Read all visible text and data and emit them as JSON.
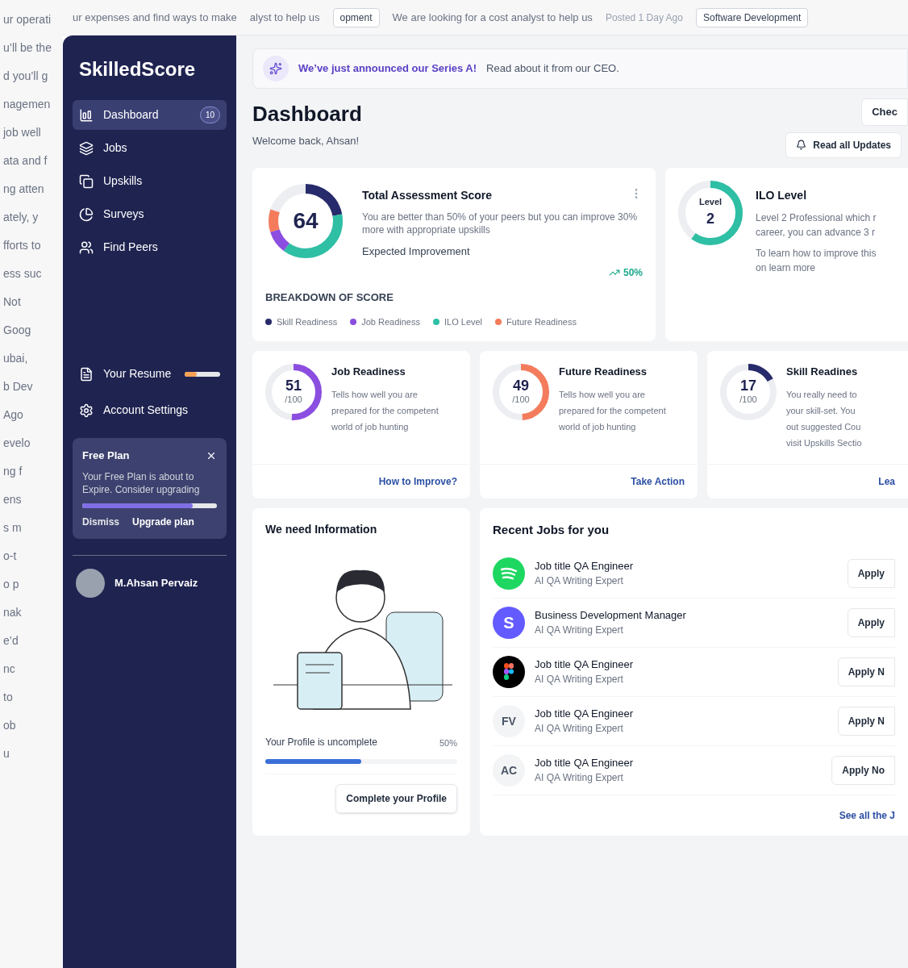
{
  "background_page": {
    "top_texts": [
      "ur expenses and find ways to make",
      "alyst to help us",
      "We are looking for a cost analyst to help us",
      "Posted 1 Day Ago"
    ],
    "tags": [
      "opment",
      "Software Development"
    ],
    "side_texts": [
      "ur operati",
      "u’ll be the",
      "d you’ll g",
      "nagemen",
      "job well",
      "ata and f",
      "ng atten",
      "ately, y",
      "fforts to",
      "ess suc",
      "Not",
      "Goog",
      "ubai,",
      "b Dev",
      "Ago",
      "evelo",
      "ng f",
      "ens",
      "s m",
      "o-t",
      "o p",
      "nak",
      "e’d",
      "nc",
      "to",
      "ob",
      "u"
    ]
  },
  "sidebar": {
    "logo": "SkilledScore",
    "nav": [
      {
        "label": "Dashboard",
        "selected": true,
        "badge": "10"
      },
      {
        "label": "Jobs",
        "selected": false
      },
      {
        "label": "Upskills",
        "selected": false
      },
      {
        "label": "Surveys",
        "selected": false
      },
      {
        "label": "Find Peers",
        "selected": false
      }
    ],
    "resume": {
      "label": "Your Resume",
      "level": 0.35
    },
    "settings": {
      "label": "Account Settings"
    },
    "plan": {
      "title": "Free Plan",
      "text": "Your Free Plan is about to Expire. Consider upgrading",
      "level": 0.82,
      "dismiss": "Dismiss",
      "upgrade": "Upgrade plan"
    },
    "user": {
      "name": "M.Ahsan Pervaiz"
    }
  },
  "banner": {
    "highlight": "We’ve just announced our Series A!",
    "text": "Read about it from our CEO."
  },
  "header": {
    "title": "Dashboard",
    "subtitle": "Welcome back, Ahsan!",
    "check_button": "Chec",
    "updates_button": "Read all Updates"
  },
  "total_score": {
    "score": "64",
    "title": "Total Assessment Score",
    "text": "You are better than 50% of your peers but you can improve 30% more with appropriate upskills",
    "improvement_label": "Expected Improvement",
    "improvement": "50%",
    "breakdown_title": "BREAKDOWN OF SCORE",
    "legend": [
      {
        "label": "Skill Readiness",
        "color": "#272b6b"
      },
      {
        "label": "Job Readiness",
        "color": "#8b4ee0"
      },
      {
        "label": "ILO Level",
        "color": "#2ebfa5"
      },
      {
        "label": "Future Readiness",
        "color": "#f47c5c"
      }
    ]
  },
  "ilo": {
    "caption": "Level",
    "value": "2",
    "level": 0.6,
    "title": "ILO Level",
    "lines": [
      "Level 2 Professional which r",
      "career, you can advance 3 r"
    ],
    "hint_lines": [
      "To learn how to improve this",
      "on learn more"
    ]
  },
  "readiness_cards": [
    {
      "score": "51",
      "max": "/100",
      "level": 0.51,
      "color": "#8b4ee0",
      "title": "Job Readiness",
      "lines": [
        "Tells how well you are",
        "prepared for the competent",
        "world of job hunting"
      ],
      "link": "How to Improve?"
    },
    {
      "score": "49",
      "max": "/100",
      "level": 0.49,
      "color": "#f47c5c",
      "title": "Future Readiness",
      "lines": [
        "Tells how well you are",
        "prepared for the competent",
        "world of job hunting"
      ],
      "link": "Take Action"
    },
    {
      "score": "17",
      "max": "/100",
      "level": 0.17,
      "color": "#272b6b",
      "title": "Skill Readines",
      "lines": [
        "You really need to",
        "your skill-set. You",
        "out suggested Cou",
        "visit Upskills Sectio"
      ],
      "link": "Lea"
    }
  ],
  "info_card": {
    "title": "We need Information",
    "progress_label": "Your Profile is uncomplete",
    "progress_value": "50%",
    "level": 0.5,
    "button": "Complete your Profile"
  },
  "jobs": {
    "title": "Recent Jobs for you",
    "link": "See all the J",
    "items": [
      {
        "kind": "music",
        "title": "Job title QA Engineer",
        "subtitle": "AI QA Writing Expert",
        "button": "Apply"
      },
      {
        "kind": "letter",
        "logo_text": "S",
        "title": "Business Development Manager",
        "subtitle": "AI QA Writing Expert",
        "button": "Apply"
      },
      {
        "kind": "design",
        "title": "Job title QA Engineer",
        "subtitle": "AI QA Writing Expert",
        "button": "Apply N"
      },
      {
        "kind": "initials",
        "logo_text": "FV",
        "title": "Job title QA Engineer",
        "subtitle": "AI QA Writing Expert",
        "button": "Apply N"
      },
      {
        "kind": "initials",
        "logo_text": "AC",
        "title": "Job title QA Engineer",
        "subtitle": "AI QA Writing Expert",
        "button": "Apply No"
      }
    ]
  }
}
